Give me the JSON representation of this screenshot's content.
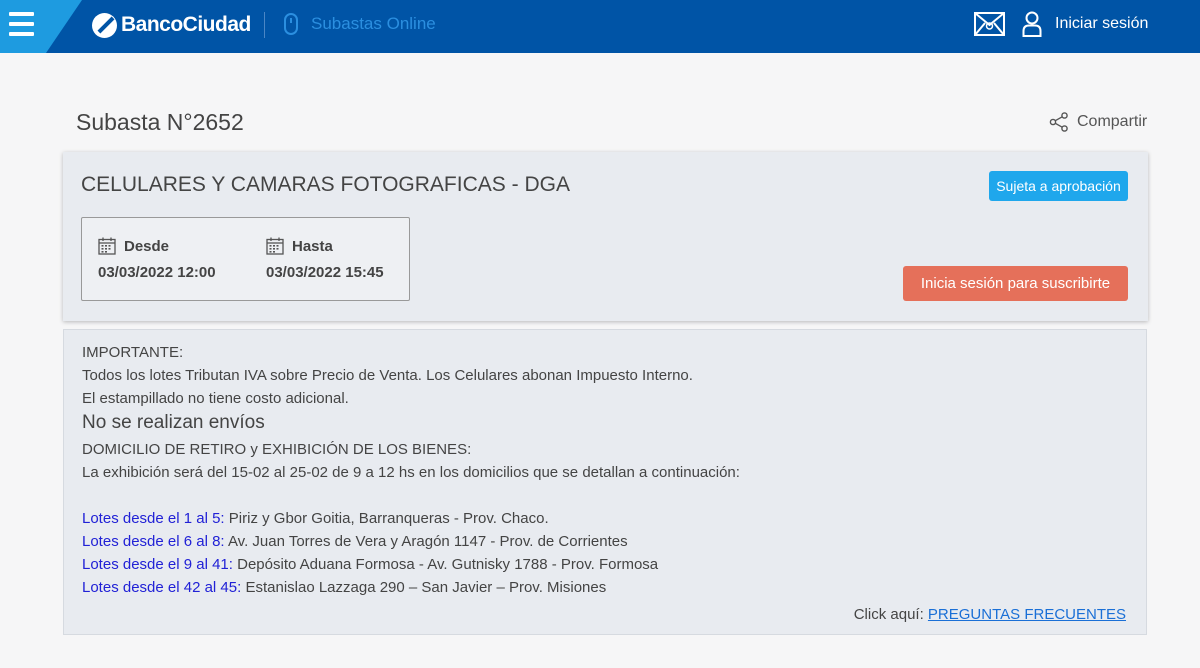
{
  "header": {
    "brand": "BancoCiudad",
    "section_title": "Subastas Online",
    "login_label": "Iniciar sesión",
    "colors": {
      "bar": "#0054a6",
      "wedge": "#1e9be0",
      "section": "#2b8fe0"
    },
    "icons": [
      "menu-icon",
      "bank-logo-icon",
      "mouse-icon",
      "mail-icon",
      "user-icon"
    ]
  },
  "page": {
    "title": "Subasta N°2652",
    "share_label": "Compartir"
  },
  "auction": {
    "name": "CELULARES Y CAMARAS FOTOGRAFICAS - DGA",
    "status": "Sujeta a aprobación",
    "from_label": "Desde",
    "from_value": "03/03/2022 12:00",
    "to_label": "Hasta",
    "to_value": "03/03/2022 15:45",
    "subscribe_label": "Inicia sesión para suscribirte",
    "colors": {
      "status": "#1fa7ec",
      "subscribe": "#e5705a"
    }
  },
  "info": {
    "l1": "IMPORTANTE:",
    "l2": "Todos los lotes Tributan IVA sobre Precio de Venta. Los Celulares abonan Impuesto Interno.",
    "l3": "El estampillado no tiene costo adicional.",
    "l4": "No se realizan envíos",
    "l5": "DOMICILIO DE RETIRO y EXHIBICIÓN DE LOS BIENES:",
    "l6": "La exhibición será del 15-02 al 25-02 de 9 a 12 hs en los domicilios que se detallan a continuación:",
    "lots": [
      {
        "range": "Lotes desde el 1 al 5:",
        "address": " Piriz y Gbor Goitia, Barranqueras - Prov. Chaco."
      },
      {
        "range": "Lotes desde el 6 al 8:",
        "address": " Av. Juan Torres de Vera y Aragón 1147 - Prov. de Corrientes"
      },
      {
        "range": "Lotes desde el 9 al 41:",
        "address": " Depósito Aduana Formosa - Av. Gutnisky 1788 - Prov. Formosa"
      },
      {
        "range": "Lotes desde el 42 al 45:",
        "address": " Estanislao Lazzaga 290 – San Javier – Prov. Misiones"
      }
    ],
    "faq_prefix": "Click aquí: ",
    "faq_link": "PREGUNTAS FRECUENTES",
    "colors": {
      "lots": "#2121d6",
      "link": "#1a6fd6"
    }
  }
}
